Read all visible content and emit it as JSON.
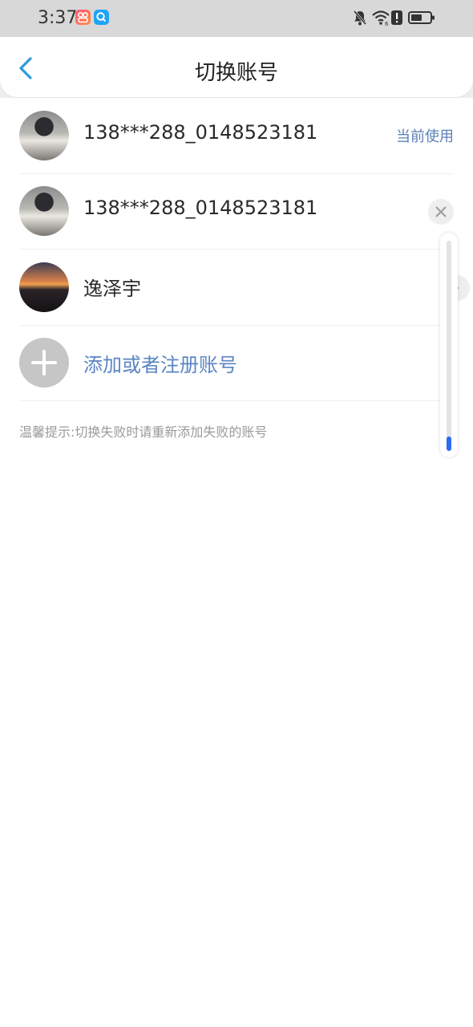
{
  "status_bar": {
    "time": "3:37",
    "apps": [
      "app-badge-red",
      "app-badge-search"
    ],
    "icons": [
      "bell-muted-icon",
      "wifi-icon",
      "alert-icon",
      "battery-icon"
    ]
  },
  "header": {
    "title": "切换账号",
    "back_icon": "chevron-left-icon"
  },
  "accounts": [
    {
      "name": "138***288_0148523181",
      "status": "当前使用",
      "avatar": "avatar-photo-1"
    },
    {
      "name": "138***288_0148523181",
      "action_icon": "close-icon",
      "avatar": "avatar-photo-1"
    },
    {
      "name": "逸泽宇",
      "action_icon": "chevron-right-icon",
      "avatar": "avatar-photo-2"
    }
  ],
  "add_account": {
    "label": "添加或者注册账号",
    "icon": "plus-icon"
  },
  "tip": "温馨提示:切换失败时请重新添加失败的账号",
  "colors": {
    "accent": "#5b85c4",
    "back": "#2b9be0",
    "scroll_thumb": "#2d6bf0"
  }
}
